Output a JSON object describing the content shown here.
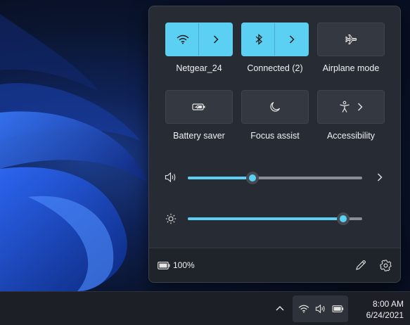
{
  "quick_settings": {
    "tiles": [
      {
        "label": "Netgear_24",
        "icon": "wifi-icon",
        "state": "on",
        "has_arrow": true
      },
      {
        "label": "Connected (2)",
        "icon": "bluetooth-icon",
        "state": "on",
        "has_arrow": true
      },
      {
        "label": "Airplane mode",
        "icon": "airplane-icon",
        "state": "off",
        "has_arrow": false
      },
      {
        "label": "Battery saver",
        "icon": "battery-saver-icon",
        "state": "off",
        "has_arrow": false
      },
      {
        "label": "Focus assist",
        "icon": "moon-icon",
        "state": "off",
        "has_arrow": false
      },
      {
        "label": "Accessibility",
        "icon": "accessibility-icon",
        "state": "off",
        "has_arrow": true
      }
    ],
    "volume": {
      "icon": "speaker-icon",
      "level": 0.37
    },
    "brightness": {
      "icon": "sun-icon",
      "level": 0.89
    },
    "footer": {
      "battery_icon": "battery-icon",
      "battery_text": "100%",
      "edit_icon": "pencil-icon",
      "settings_icon": "gear-icon"
    }
  },
  "taskbar": {
    "tray_icons": [
      "chevron-up-icon",
      "wifi-icon",
      "speaker-icon",
      "battery-icon"
    ],
    "time": "8:00 AM",
    "date": "6/24/2021"
  },
  "colors": {
    "accent": "#5bd0f3",
    "panel": "#272b34",
    "tile_off": "#343841",
    "taskbar": "#1c1f26"
  }
}
